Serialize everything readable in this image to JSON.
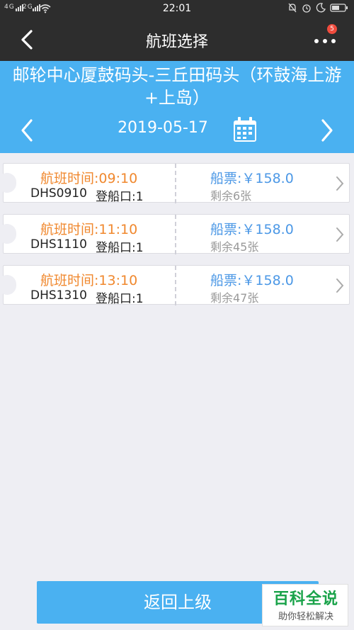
{
  "status_bar": {
    "network_left": "4G",
    "network_right": "2G",
    "time": "22:01"
  },
  "nav": {
    "title": "航班选择",
    "badge_count": "5"
  },
  "route": {
    "name": "邮轮中心厦鼓码头-三丘田码头（环鼓海上游+上岛）",
    "date": "2019-05-17"
  },
  "flights": [
    {
      "time": "航班时间:09:10",
      "code": "DHS0910",
      "gate": "登船口:1",
      "price": "船票:￥158.0",
      "remaining": "剩余6张"
    },
    {
      "time": "航班时间:11:10",
      "code": "DHS1110",
      "gate": "登船口:1",
      "price": "船票:￥158.0",
      "remaining": "剩余45张"
    },
    {
      "time": "航班时间:13:10",
      "code": "DHS1310",
      "gate": "登船口:1",
      "price": "船票:￥158.0",
      "remaining": "剩余47张"
    }
  ],
  "footer": {
    "return_label": "返回上级"
  },
  "watermark": {
    "title": "百科全说",
    "subtitle": "助你轻松解决"
  },
  "colors": {
    "header_bg": "#2d2d2d",
    "accent_blue": "#4ab1f1",
    "time_orange": "#f0882e",
    "price_blue": "#4c98e6",
    "badge_red": "#f04c3e"
  }
}
